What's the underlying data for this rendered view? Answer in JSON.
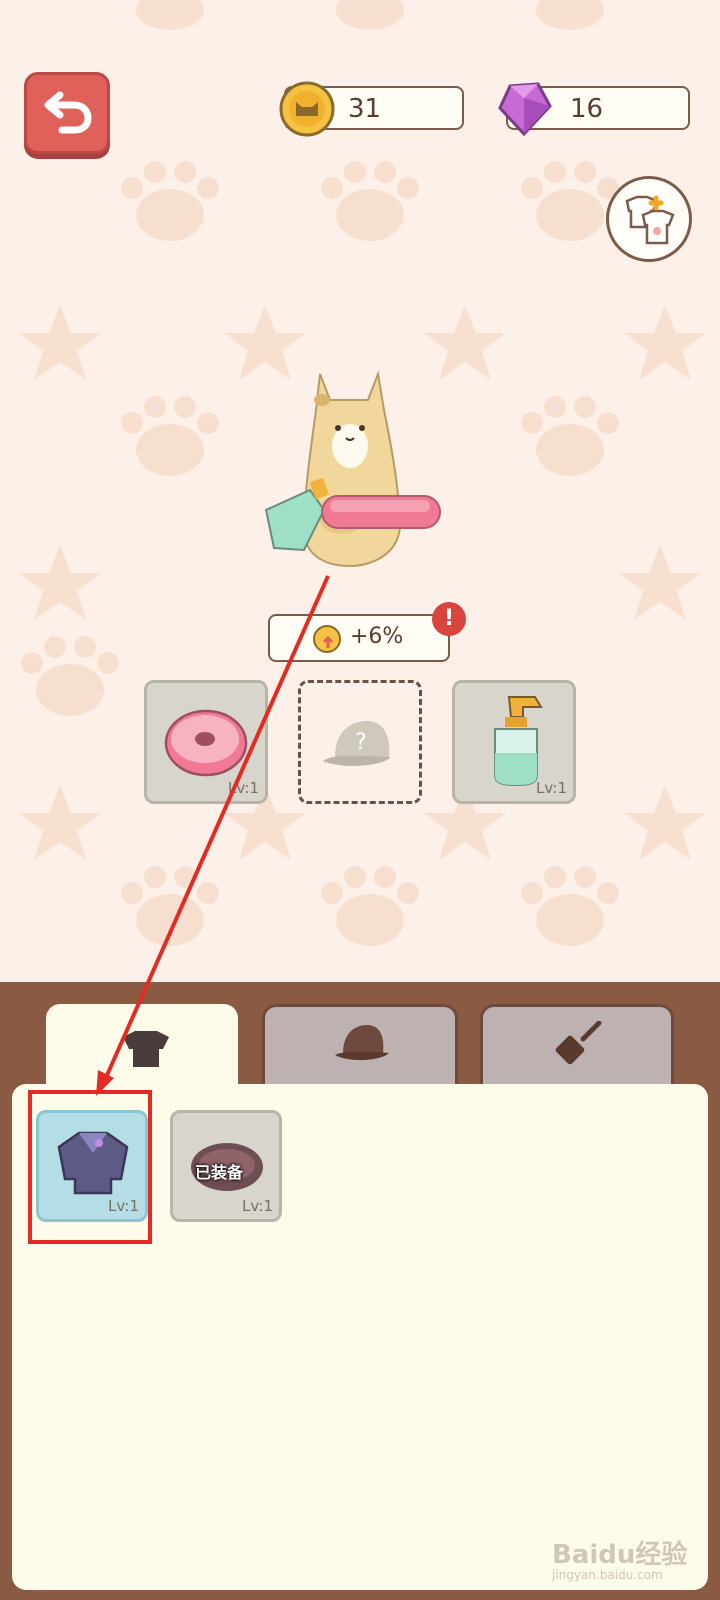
{
  "currency": {
    "coins": "31",
    "gems": "16"
  },
  "bonus": {
    "text": "+6%",
    "alert": "!"
  },
  "equip_slots": [
    {
      "name": "donut",
      "level": "Lv:1"
    },
    {
      "name": "hat-empty",
      "level": ""
    },
    {
      "name": "spray-bottle",
      "level": "Lv:1"
    }
  ],
  "tabs": [
    {
      "name": "clothes",
      "icon": "shirt-icon"
    },
    {
      "name": "hats",
      "icon": "cap-icon"
    },
    {
      "name": "tools",
      "icon": "spatula-icon"
    }
  ],
  "inventory": [
    {
      "name": "purple-jacket",
      "level": "Lv:1",
      "equipped_label": ""
    },
    {
      "name": "donut",
      "level": "Lv:1",
      "equipped_label": "已装备"
    }
  ],
  "watermark": {
    "text": "Baidu经验",
    "sub": "jingyan.baidu.com"
  },
  "colors": {
    "background": "#fdf0e8",
    "back_button": "#e0605a",
    "panel_frame": "#8a5a42",
    "panel_content": "#fffbea",
    "highlight": "#e32b23"
  }
}
